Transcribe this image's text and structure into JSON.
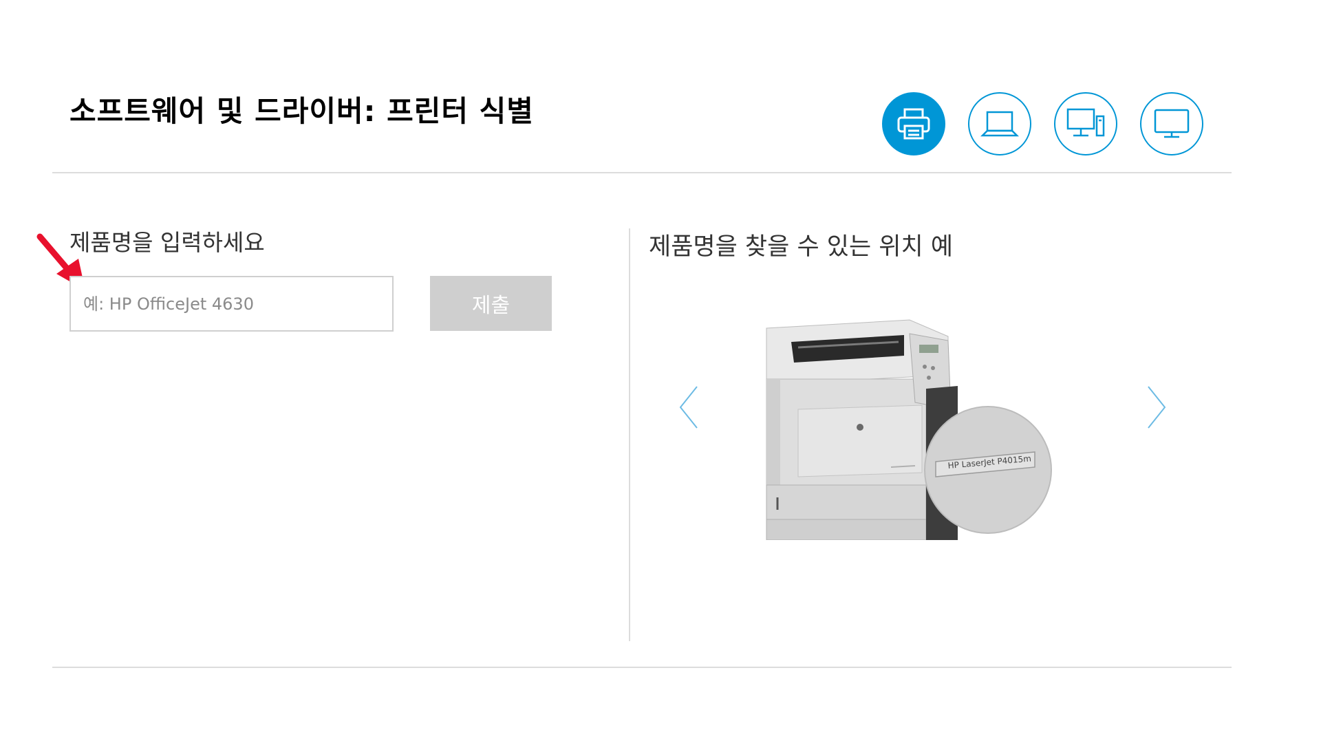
{
  "header": {
    "title": "소프트웨어 및 드라이버: 프린터 식별",
    "device_types": [
      {
        "name": "printer-icon",
        "active": true
      },
      {
        "name": "laptop-icon",
        "active": false
      },
      {
        "name": "desktop-icon",
        "active": false
      },
      {
        "name": "monitor-icon",
        "active": false
      }
    ]
  },
  "form": {
    "label": "제품명을 입력하세요",
    "placeholder": "예: HP OfficeJet 4630",
    "value": "",
    "submit_label": "제출"
  },
  "example": {
    "label": "제품명을 찾을 수 있는 위치 예",
    "image_model_label": "HP LaserJet P4015m",
    "prev_icon": "chevron-left-icon",
    "next_icon": "chevron-right-icon"
  },
  "colors": {
    "accent": "#0096d6",
    "annotation_arrow": "#e8112d",
    "button_disabled": "#cfcfcf",
    "divider": "#dcdcdc"
  }
}
